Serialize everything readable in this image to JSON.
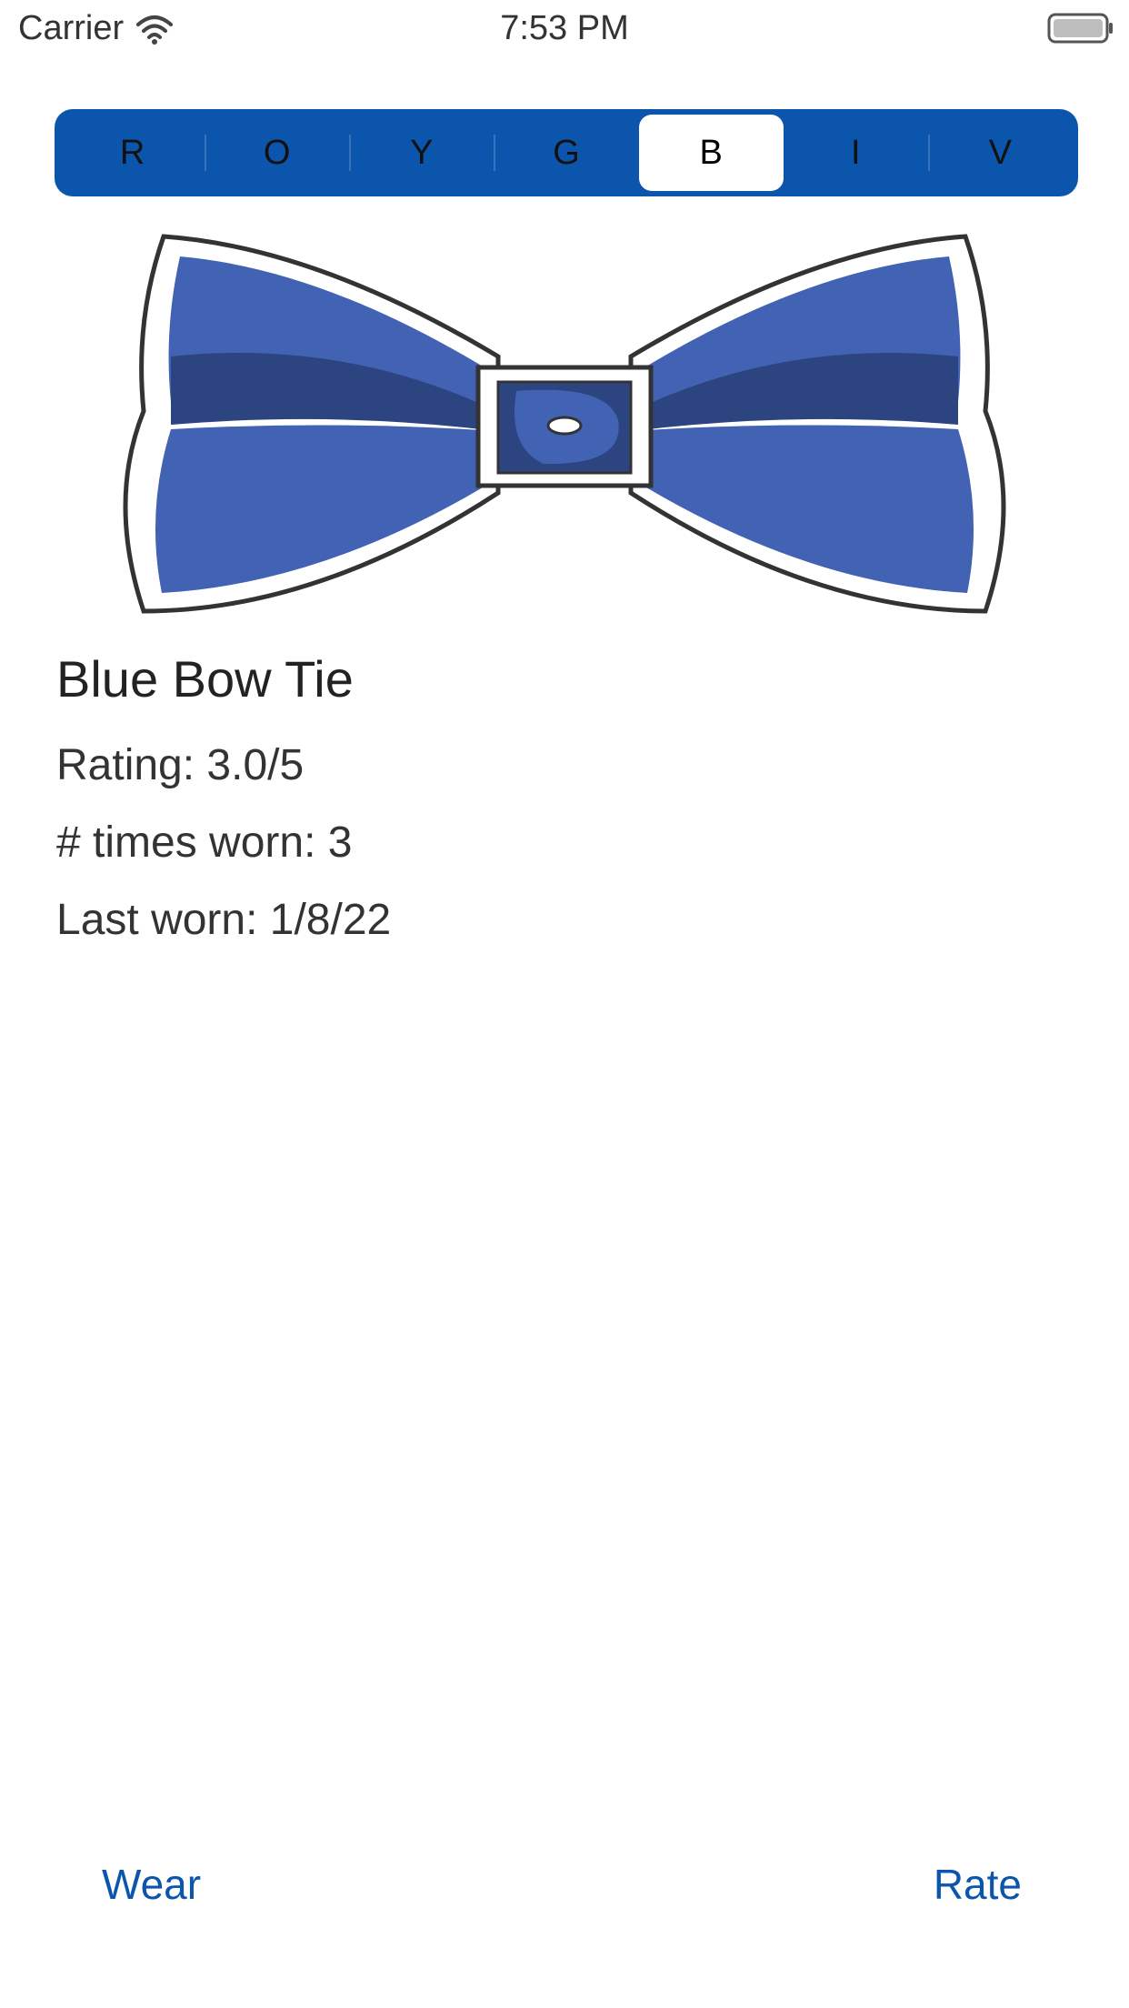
{
  "status_bar": {
    "carrier": "Carrier",
    "time": "7:53 PM"
  },
  "color_picker": {
    "segments": [
      "R",
      "O",
      "Y",
      "G",
      "B",
      "I",
      "V"
    ],
    "selected": "B",
    "background_color": "#0b55ad"
  },
  "item": {
    "image_icon": "blue-bow-tie",
    "image_color": "#4263b3",
    "title": "Blue Bow Tie",
    "rating": "Rating: 3.0/5",
    "times_worn": "# times worn: 3",
    "last_worn": "Last worn: 1/8/22"
  },
  "actions": {
    "wear_label": "Wear",
    "rate_label": "Rate",
    "link_color": "#0b55ad"
  }
}
